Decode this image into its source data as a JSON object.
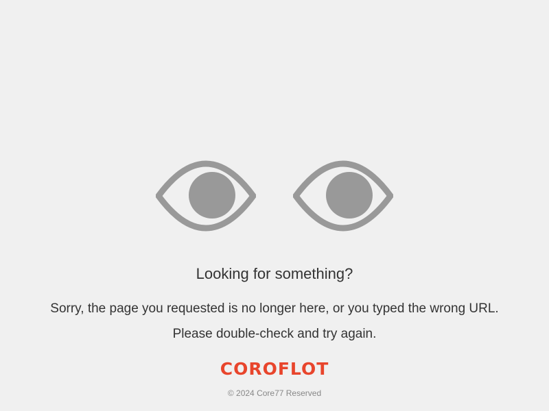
{
  "illustration": {
    "left_eye_icon": "eye-icon",
    "right_eye_icon": "eye-icon",
    "eye_color": "#999999"
  },
  "content": {
    "headline": "Looking for something?",
    "message_line1": "Sorry, the page you requested is no longer here, or you typed the wrong URL.",
    "message_line2": "Please double-check and try again."
  },
  "footer": {
    "brand": "COROFLOT",
    "brand_color": "#e8452c",
    "copyright": "© 2024 Core77 Reserved"
  }
}
